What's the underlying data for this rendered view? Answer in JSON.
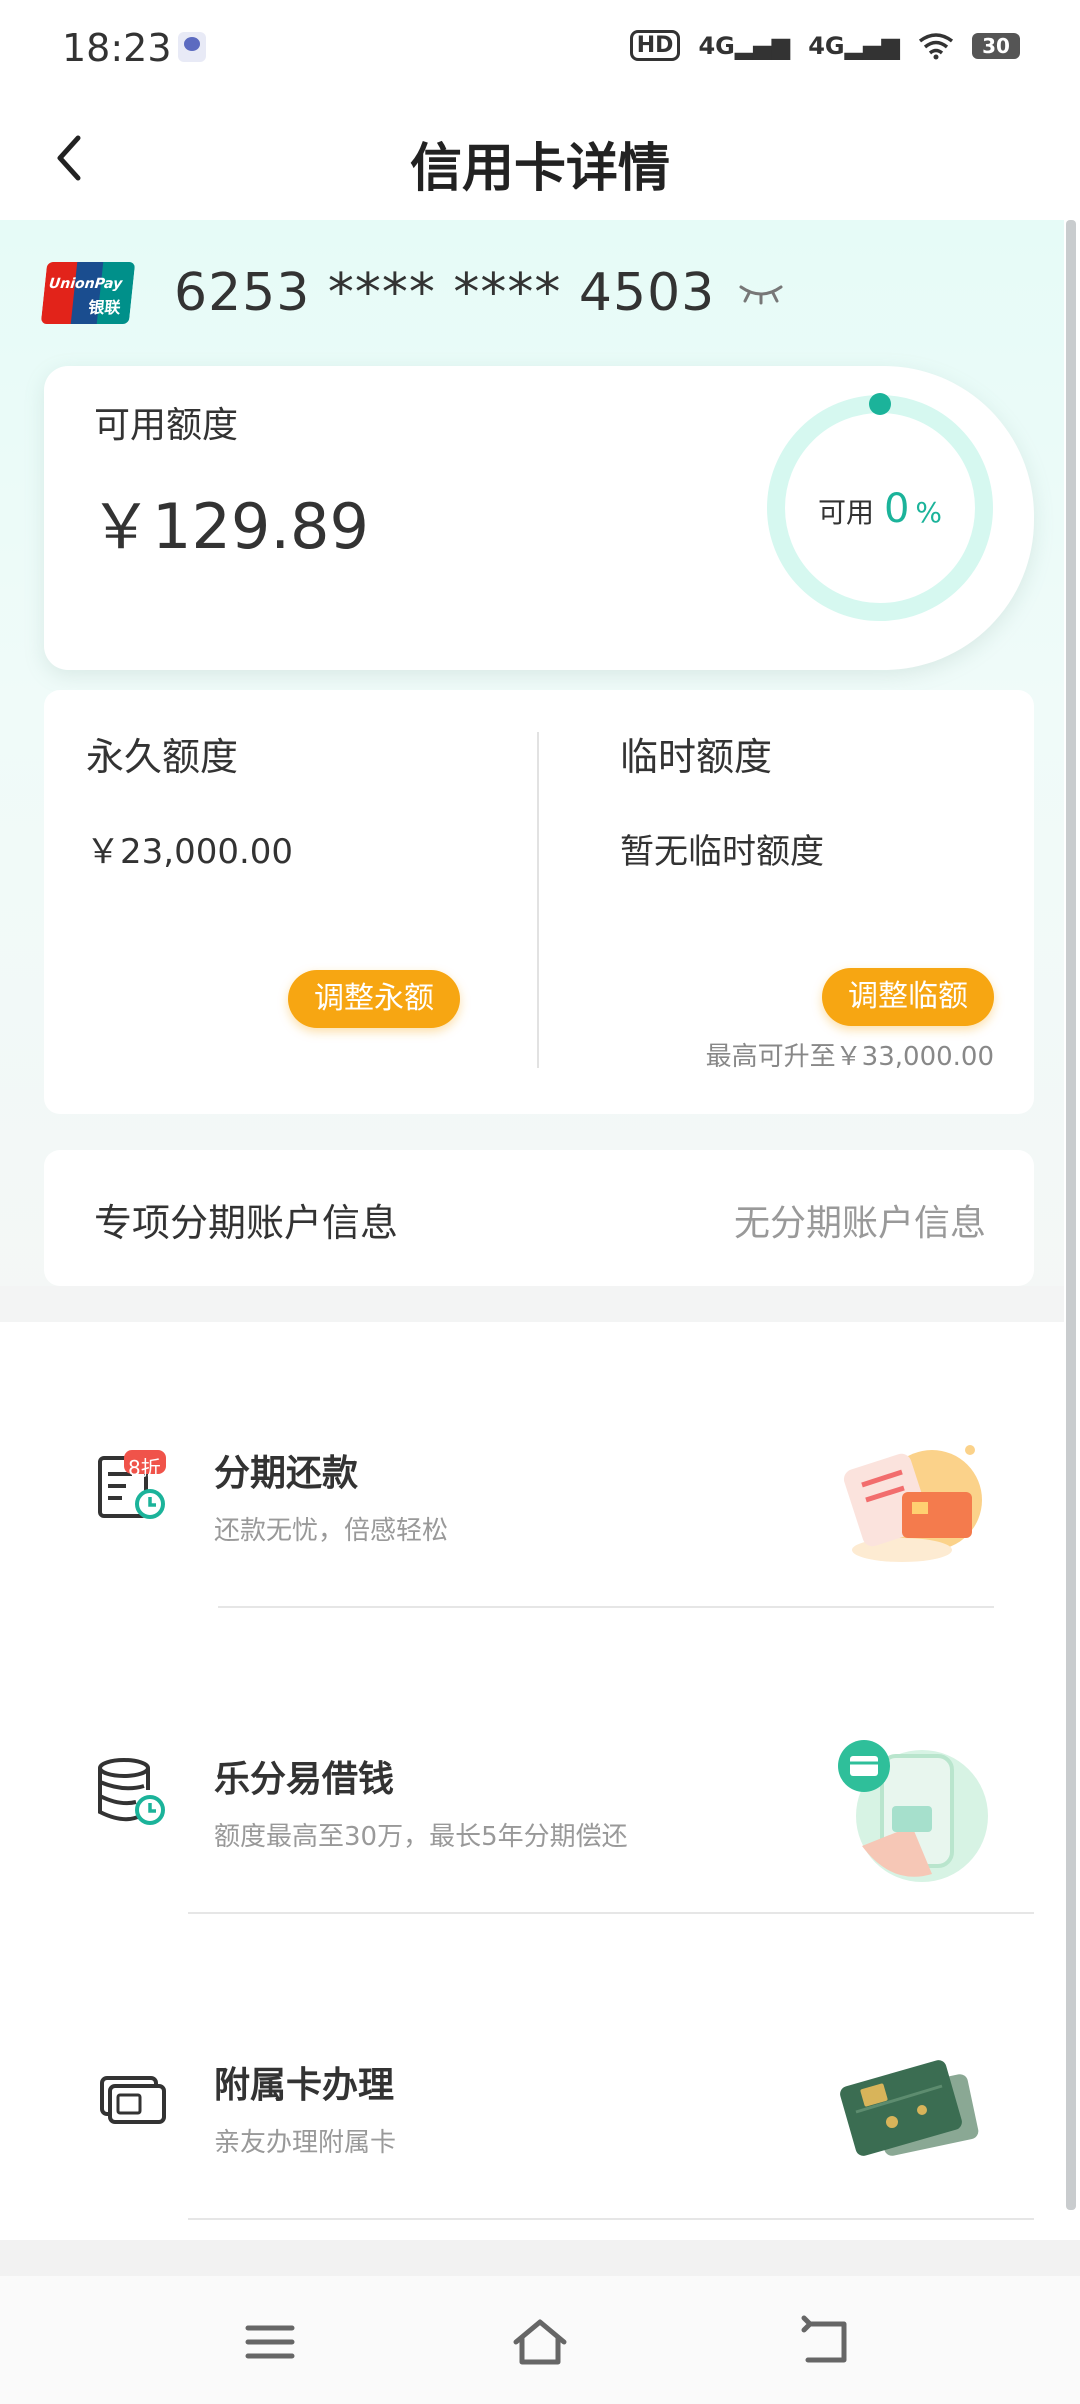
{
  "status_bar": {
    "time": "18:23",
    "hd": "HD",
    "signal1": "4G",
    "signal2": "4G",
    "battery": "30"
  },
  "header": {
    "title": "信用卡详情",
    "back_icon": "chevron-left-icon"
  },
  "card": {
    "brand_line1": "UnionPay",
    "brand_line2": "银联",
    "number": "6253 **** **** 4503",
    "eye_icon": "eye-closed-icon"
  },
  "available": {
    "label": "可用额度",
    "amount": "￥129.89",
    "ring_label": "可用",
    "ring_percent": "0",
    "ring_unit": "%",
    "ring_fraction": 0
  },
  "quota": {
    "permanent_title": "永久额度",
    "permanent_value": "￥23,000.00",
    "permanent_button": "调整永额",
    "temporary_title": "临时额度",
    "temporary_value": "暂无临时额度",
    "temporary_button": "调整临额",
    "temporary_note": "最高可升至￥33,000.00"
  },
  "installment_account": {
    "label": "专项分期账户信息",
    "value": "无分期账户信息"
  },
  "services": [
    {
      "title": "分期还款",
      "subtitle": "还款无忧，倍感轻松",
      "badge": "8折",
      "icon": "bill-clock-icon"
    },
    {
      "title": "乐分易借钱",
      "subtitle": "额度最高至30万，最长5年分期偿还",
      "icon": "coins-clock-icon"
    },
    {
      "title": "附属卡办理",
      "subtitle": "亲友办理附属卡",
      "icon": "cards-icon"
    }
  ],
  "nav": {
    "menu_icon": "menu-icon",
    "home_icon": "home-icon",
    "back_icon": "back-icon"
  },
  "colors": {
    "accent": "#1bb39a",
    "ring_track": "#d6f8f0",
    "button": "#f7a612",
    "mint_bg": "#e6fbf7"
  }
}
